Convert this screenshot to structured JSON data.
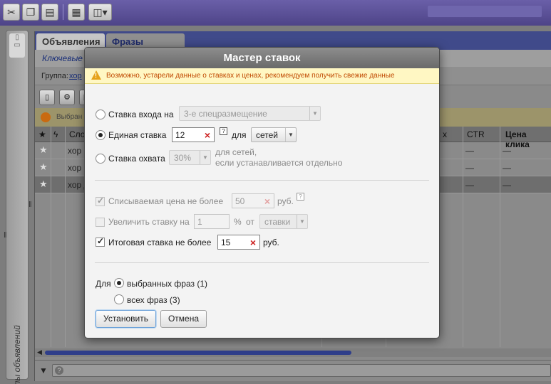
{
  "background": {
    "tabs": [
      "Объявления",
      "Фразы"
    ],
    "subtab": "Ключевые",
    "group_label": "Группа:",
    "group_link": "хор",
    "notice": "Выбран",
    "columns": [
      "Сло",
      "х",
      "CTR",
      "Цена клика"
    ],
    "rows": [
      {
        "text": "хор с",
        "c1": "—",
        "c2": "—"
      },
      {
        "text": "хор с",
        "c1": "—",
        "c2": "—"
      },
      {
        "text": "хор д",
        "c1": "—",
        "c2": "—"
      }
    ],
    "left_panel_label": "Группы объявлений"
  },
  "dialog": {
    "title": "Мастер ставок",
    "warning": "Возможно, устарели данные о ставках и ценах, рекомендуем получить свежие данные",
    "entry_bid": {
      "label": "Ставка входа на",
      "value": "3-е спецразмещение",
      "selected": false
    },
    "single_bid": {
      "label": "Единая ставка",
      "value": "12",
      "for_label": "для",
      "target": "сетей",
      "selected": true
    },
    "coverage_bid": {
      "label": "Ставка охвата",
      "value": "30%",
      "note_line1": "для сетей,",
      "note_line2": "если устанавливается отдельно",
      "selected": false
    },
    "max_charge": {
      "label": "Списываемая цена не более",
      "value": "50",
      "unit": "руб.",
      "checked": true,
      "disabled": true
    },
    "increase": {
      "label": "Увеличить ставку на",
      "value": "1",
      "unit": "%",
      "of_label": "от",
      "base": "ставки",
      "checked": false,
      "disabled": true
    },
    "final_bid": {
      "label": "Итоговая ставка не более",
      "value": "15",
      "unit": "руб.",
      "checked": true
    },
    "scope": {
      "for_label": "Для",
      "selected_phrases": "выбранных фраз (1)",
      "all_phrases": "всех фраз (3)",
      "selected": "selected_phrases"
    },
    "buttons": {
      "apply": "Установить",
      "cancel": "Отмена"
    }
  },
  "colors": {
    "toolbar": "#5a51a0",
    "tab_header": "#404a8a",
    "warning_bg": "#fff7c3",
    "warning_text": "#c04800",
    "clear_x": "#cc1e1e"
  }
}
